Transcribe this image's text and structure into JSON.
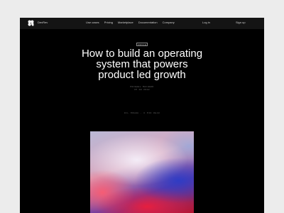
{
  "header": {
    "brand": "DevRev",
    "nav": [
      {
        "label": "Use cases"
      },
      {
        "label": "Pricing"
      },
      {
        "label": "Marketplace"
      },
      {
        "label": "Documentation"
      },
      {
        "label": "Company"
      }
    ],
    "login_label": "Log in",
    "signup_label": "Sign up"
  },
  "article": {
    "tag": "CIRCLE",
    "title_lines": [
      "How to build an operating",
      "system that powers",
      "product led growth"
    ],
    "author": "MICHAEL MACHADO",
    "date": "15 08 2022",
    "read_time": "DIL MOHBH · 6 MIN READ"
  },
  "colors": {
    "page_background": "#000000",
    "nav_background": "#141414",
    "text_primary": "#ffffff",
    "text_muted": "#6e6e6e"
  },
  "icons": {
    "logo": "devrev-logo-icon"
  }
}
